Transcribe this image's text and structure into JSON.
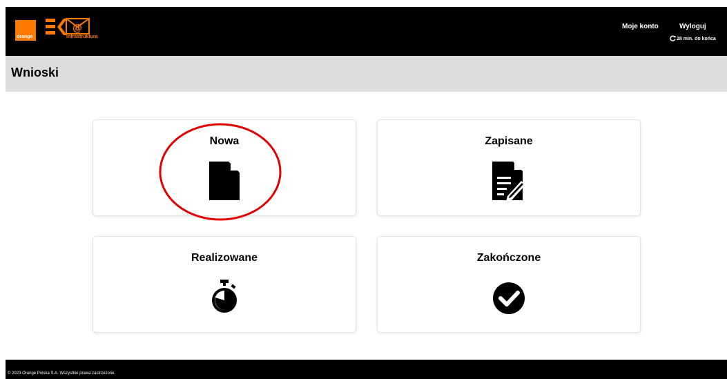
{
  "header": {
    "brand": "orange",
    "logo_text": "infrastruktura",
    "account_link": "Moje konto",
    "logout_link": "Wyloguj",
    "session_timer": "28 min. do końca"
  },
  "page": {
    "title": "Wnioski"
  },
  "tiles": [
    {
      "label": "Nowa",
      "icon": "new-document-icon"
    },
    {
      "label": "Zapisane",
      "icon": "document-edit-icon"
    },
    {
      "label": "Realizowane",
      "icon": "stopwatch-icon"
    },
    {
      "label": "Zakończone",
      "icon": "check-circle-icon"
    }
  ],
  "footer": {
    "copyright": "© 2023 Orange Polska S.A. Wszystkie prawa zastrzeżone."
  },
  "colors": {
    "brand_orange": "#ff7900",
    "header_bg": "#000000",
    "title_bar_bg": "#dcdcdc",
    "highlight": "#e00000"
  }
}
